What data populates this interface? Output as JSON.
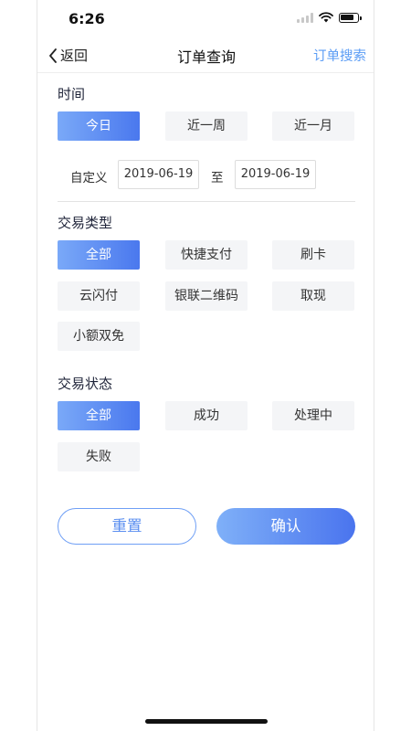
{
  "status_bar": {
    "time": "6:26",
    "battery_level": 0.8,
    "icons": [
      "signal-icon",
      "wifi-icon",
      "battery-icon"
    ]
  },
  "nav": {
    "back_label": "返回",
    "title": "订单查询",
    "right_action": "订单搜索"
  },
  "colors": {
    "accent": "#4a78ee",
    "accent_light": "#7aa9f8",
    "link": "#5a9cf5",
    "option_bg": "#f4f5f7"
  },
  "time_section": {
    "title": "时间",
    "options": [
      "今日",
      "近一周",
      "近一月"
    ],
    "selected": "今日",
    "custom_label": "自定义",
    "start_date": "2019-06-19",
    "to_label": "至",
    "end_date": "2019-06-19"
  },
  "type_section": {
    "title": "交易类型",
    "options": [
      "全部",
      "快捷支付",
      "刷卡",
      "云闪付",
      "银联二维码",
      "取现",
      "小额双免"
    ],
    "selected": "全部"
  },
  "status_section": {
    "title": "交易状态",
    "options": [
      "全部",
      "成功",
      "处理中",
      "失败"
    ],
    "selected": "全部"
  },
  "actions": {
    "reset_label": "重置",
    "confirm_label": "确认"
  }
}
